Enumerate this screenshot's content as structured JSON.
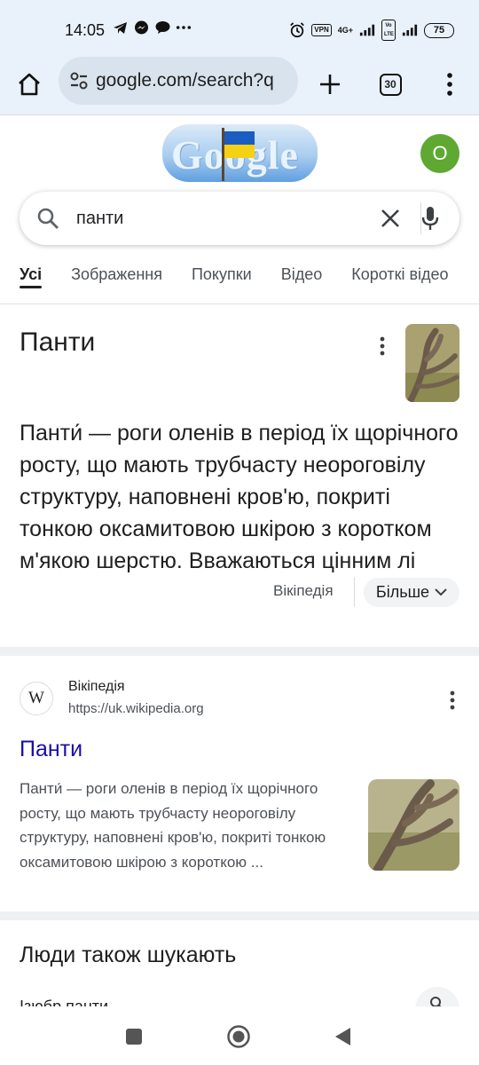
{
  "status_bar": {
    "time": "14:05",
    "left_icons": [
      "telegram-icon",
      "messenger-icon",
      "chat-bubble-icon",
      "more-dots-icon"
    ],
    "vpn": "VPN",
    "network": "4G+",
    "volte": "Vo LTE",
    "battery": "75"
  },
  "toolbar": {
    "url": "google.com/search?q",
    "tab_count": "30"
  },
  "header": {
    "doodle_text": "Google",
    "avatar_letter": "O"
  },
  "search": {
    "query": "панти"
  },
  "tabs": [
    {
      "label": "Усі",
      "active": true
    },
    {
      "label": "Зображення",
      "active": false
    },
    {
      "label": "Покупки",
      "active": false
    },
    {
      "label": "Відео",
      "active": false
    },
    {
      "label": "Короткі відео",
      "active": false
    }
  ],
  "knowledge_panel": {
    "title": "Панти",
    "description": "Панти́ — роги оленів в період їх щорічного росту, що мають трубчасту неороговілу структуру, наповнені кров'ю, покриті тонкою оксамитовою шкірою з коротком м'якою шерстю. Вважаються цінним лі",
    "source": "Вікіпедія",
    "more_label": "Більше"
  },
  "result": {
    "favicon_letter": "W",
    "site_name": "Вікіпедія",
    "url": "https://uk.wikipedia.org",
    "title": "Панти",
    "snippet": "Панти́ — роги оленів в період їх щорічного росту, що мають трубчасту неороговілу структуру, наповнені кров'ю, покриті тонкою оксамитовою шкірою з короткою ..."
  },
  "people_also_search": {
    "title": "Люди також шукають",
    "first_item": "Ізюбр панти"
  },
  "colors": {
    "link_blue": "#1a0dab",
    "avatar_green": "#5fa832",
    "browser_chrome": "#e9f2fb"
  }
}
